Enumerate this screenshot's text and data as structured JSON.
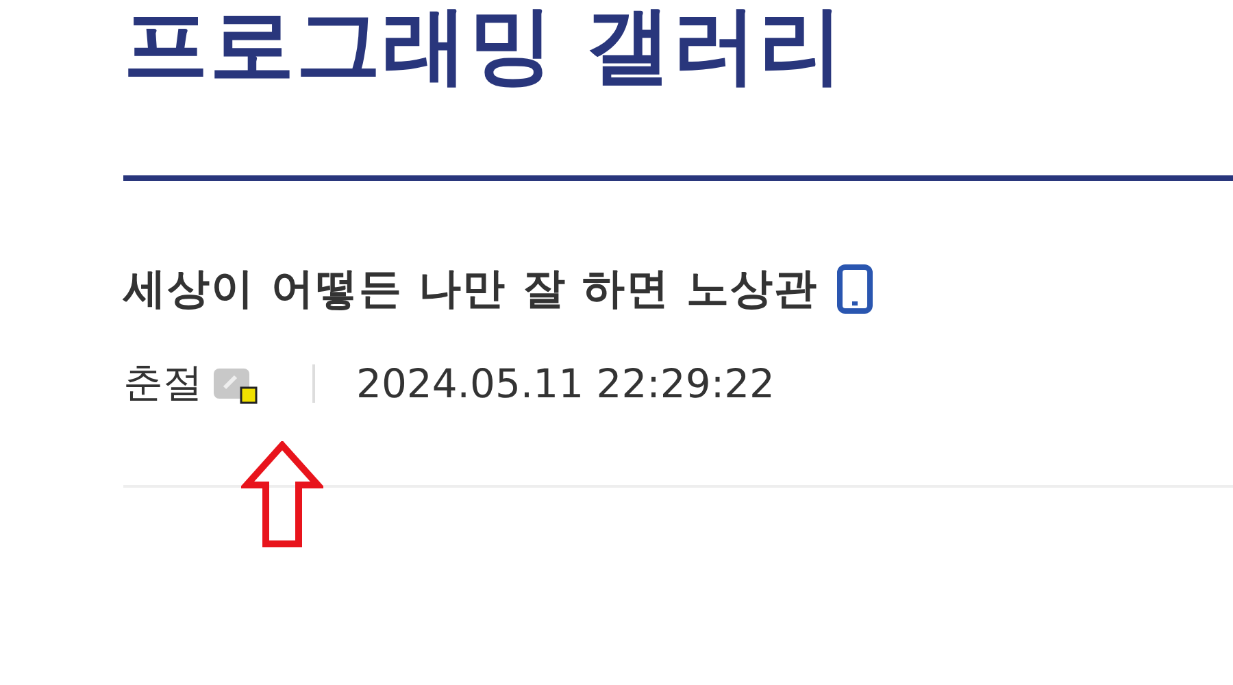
{
  "gallery_title": "프로그래밍 갤러리",
  "post": {
    "title": "세상이 어떻든 나만 잘 하면 노상관",
    "author": "춘절",
    "date": "2024.05.11 22:29:22"
  }
}
